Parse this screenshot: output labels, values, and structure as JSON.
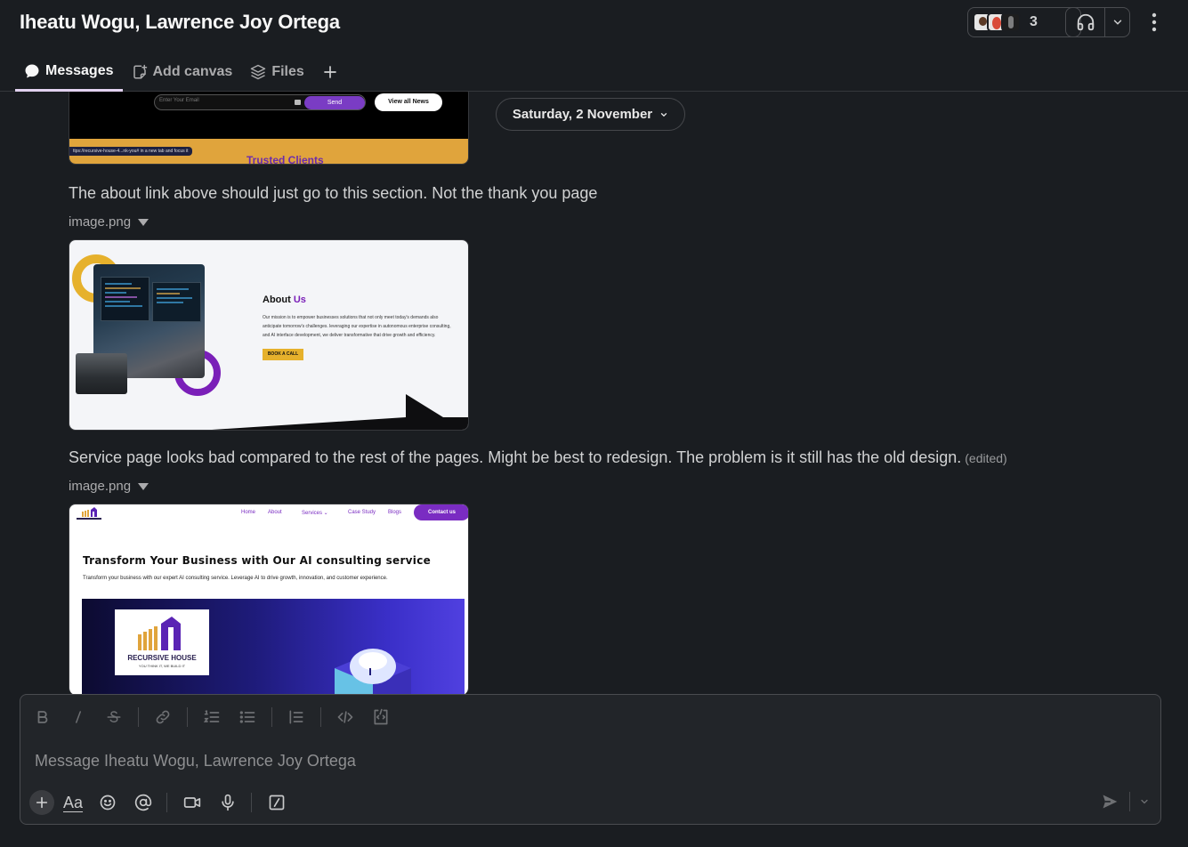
{
  "header": {
    "title": "Iheatu Wogu, Lawrence Joy Ortega",
    "member_count": "3"
  },
  "tabs": [
    {
      "label": "Messages",
      "icon": "message-bubble-icon",
      "active": true
    },
    {
      "label": "Add canvas",
      "icon": "canvas-icon",
      "active": false
    },
    {
      "label": "Files",
      "icon": "layers-icon",
      "active": false
    }
  ],
  "feed": {
    "date_divider": "Saturday, 2 November",
    "screenshot1": {
      "email_placeholder": "Enter Your Email",
      "send_label": "Send",
      "view_all_label": "View all News",
      "url_text": "ttps://recursive-house-4...nk-you# in a new tab and focus it",
      "section_title": "Trusted Clients"
    },
    "messages": [
      {
        "text": "The about link above should just go to this section. Not the thank you page",
        "file_name": "image.png",
        "edited": ""
      },
      {
        "text": "Service page looks bad compared to the rest of the pages. Might be best to redesign. The problem is it still has the old design.",
        "file_name": "image.png",
        "edited": "(edited)"
      }
    ],
    "screenshot2": {
      "heading_prefix": "About",
      "heading_accent": "Us",
      "body": "Our mission is to empower businesses solutions that not only meet today's demands also anticipate tomorrow's challenges. leveraging our expertise in autonomous enterprise consulting, and AI interface development, we deliver transformative that drive growth and efficiency.",
      "cta": "BOOK A CALL"
    },
    "screenshot3": {
      "nav": [
        "Home",
        "About",
        "Services ⌄",
        "Case Study",
        "Blogs"
      ],
      "contact": "Contact us",
      "heading": "Transform Your Business with Our AI consulting service",
      "subheading": "Transform your business with our expert AI consulting service. Leverage AI to drive growth, innovation, and customer experience.",
      "logo_name": "RECURSIVE HOUSE",
      "logo_tagline": "YOU THINK IT, WE BUILD IT"
    }
  },
  "composer": {
    "placeholder": "Message Iheatu Wogu, Lawrence Joy Ortega",
    "format_label": "Aa"
  },
  "colors": {
    "background": "#1a1d21",
    "composer_bg": "#222529",
    "accent_purple": "#7a2cc2",
    "accent_yellow": "#e6b12c"
  }
}
